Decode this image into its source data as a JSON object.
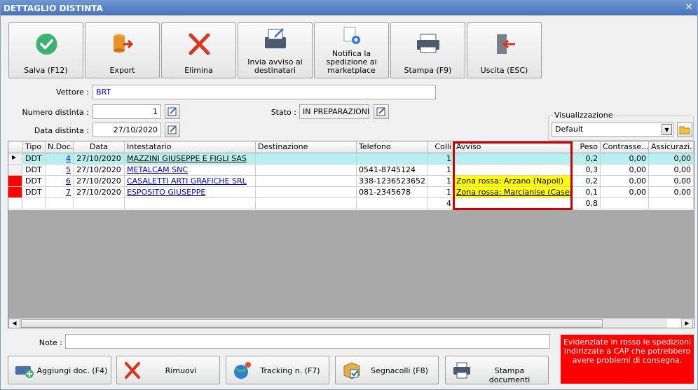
{
  "window": {
    "title": "DETTAGLIO DISTINTA"
  },
  "toolbar": [
    {
      "label": "Salva (F12)",
      "icon": "check-icon"
    },
    {
      "label": "Export",
      "icon": "export-icon"
    },
    {
      "label": "Elimina",
      "icon": "delete-x-icon"
    },
    {
      "label": "Invia avviso ai destinatari",
      "icon": "notice-print-icon"
    },
    {
      "label": "Notifica la spedizione ai marketplace",
      "icon": "document-gear-icon"
    },
    {
      "label": "Stampa (F9)",
      "icon": "printer-icon"
    },
    {
      "label": "Uscita (ESC)",
      "icon": "exit-door-icon"
    }
  ],
  "form": {
    "vettore_label": "Vettore :",
    "vettore_value": "BRT",
    "numero_label": "Numero distinta :",
    "numero_value": "1",
    "data_label": "Data distinta :",
    "data_value": "27/10/2020",
    "stato_label": "Stato :",
    "stato_value": "IN PREPARAZIONE"
  },
  "visualizzazione": {
    "label": "Visualizzazione",
    "selected": "Default"
  },
  "table": {
    "columns": [
      "Tipo",
      "N.Doc.",
      "Data",
      "Intestatario",
      "Destinazione",
      "Telefono",
      "Colli",
      "Avviso",
      "Peso",
      "Contrasse...",
      "Assicurazi..."
    ],
    "rows": [
      {
        "marker": "current",
        "tipo": "DDT",
        "ndoc": "4",
        "data": "27/10/2020",
        "intestatario": "MAZZINI GIUSEPPE E FIGLI SAS",
        "destinazione": "",
        "telefono": "",
        "colli": "1",
        "avviso": "",
        "peso": "0,2",
        "contrassegno": "0,00",
        "assicurazione": "0,00"
      },
      {
        "marker": "",
        "tipo": "DDT",
        "ndoc": "5",
        "data": "27/10/2020",
        "intestatario": "METALCAM SNC",
        "destinazione": "",
        "telefono": "0541-8745124",
        "colli": "1",
        "avviso": "",
        "peso": "0,3",
        "contrassegno": "0,00",
        "assicurazione": "0,00"
      },
      {
        "marker": "red",
        "tipo": "DDT",
        "ndoc": "6",
        "data": "27/10/2020",
        "intestatario": "CASALETTI ARTI GRAFICHE SRL",
        "destinazione": "",
        "telefono": "338-1236523652",
        "colli": "1",
        "avviso": "Zona rossa: Arzano (Napoli)",
        "peso": "0,2",
        "contrassegno": "0,00",
        "assicurazione": "0,00"
      },
      {
        "marker": "red",
        "tipo": "DDT",
        "ndoc": "7",
        "data": "27/10/2020",
        "intestatario": "ESPOSITO GIUSEPPE",
        "destinazione": "",
        "telefono": "081-2345678",
        "colli": "1",
        "avviso": "Zona rossa: Marcianise (Caserta)",
        "peso": "0,1",
        "contrassegno": "0,00",
        "assicurazione": "0,00"
      }
    ],
    "totals": {
      "colli": "4",
      "peso": "0,8"
    }
  },
  "note": {
    "label": "Note :",
    "value": ""
  },
  "legend": {
    "text": "Evidenziate in rosso le spedizioni indirizzate a CAP che potrebbero avere problemi di consegna."
  },
  "bottom_buttons": [
    {
      "label": "Aggiungi doc. (F4)",
      "icon": "add-document-icon"
    },
    {
      "label": "Rimuovi",
      "icon": "remove-x-icon"
    },
    {
      "label": "Tracking n. (F7)",
      "icon": "globe-icon"
    },
    {
      "label": "Segnacolli (F8)",
      "icon": "package-label-icon"
    },
    {
      "label": "Stampa documenti",
      "icon": "printer-icon"
    }
  ],
  "colors": {
    "accent_row": "#b4f0f0",
    "warning_fill": "#ffff00",
    "alert_red": "#ff0000",
    "highlight_border": "#cc0000"
  }
}
